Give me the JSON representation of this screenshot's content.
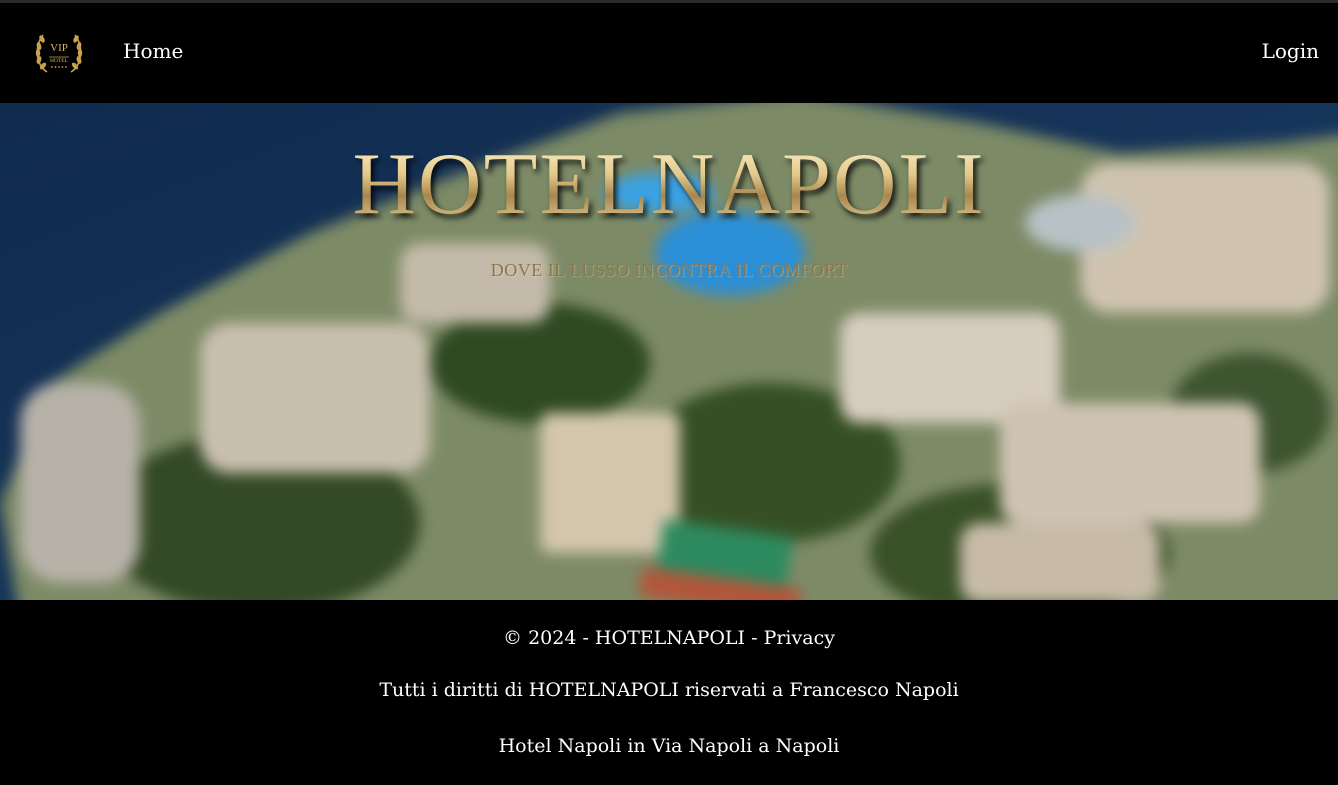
{
  "nav": {
    "logo_text": "VIP HOTEL",
    "home_label": "Home",
    "login_label": "Login"
  },
  "hero": {
    "title": "HOTELNAPOLI",
    "subtitle": "DOVE IL LUSSO INCONTRA IL COMFORT"
  },
  "footer": {
    "copyright_prefix": "© 2024 - HOTELNAPOLI - ",
    "privacy_label": "Privacy",
    "rights_text": "Tutti i diritti di HOTELNAPOLI riservati a Francesco Napoli",
    "address_text": "Hotel Napoli in Via Napoli a Napoli"
  },
  "colors": {
    "background": "#000000",
    "title_gold": "#e4c98a",
    "subtitle_gold": "#8a7653",
    "text": "#ffffff"
  }
}
